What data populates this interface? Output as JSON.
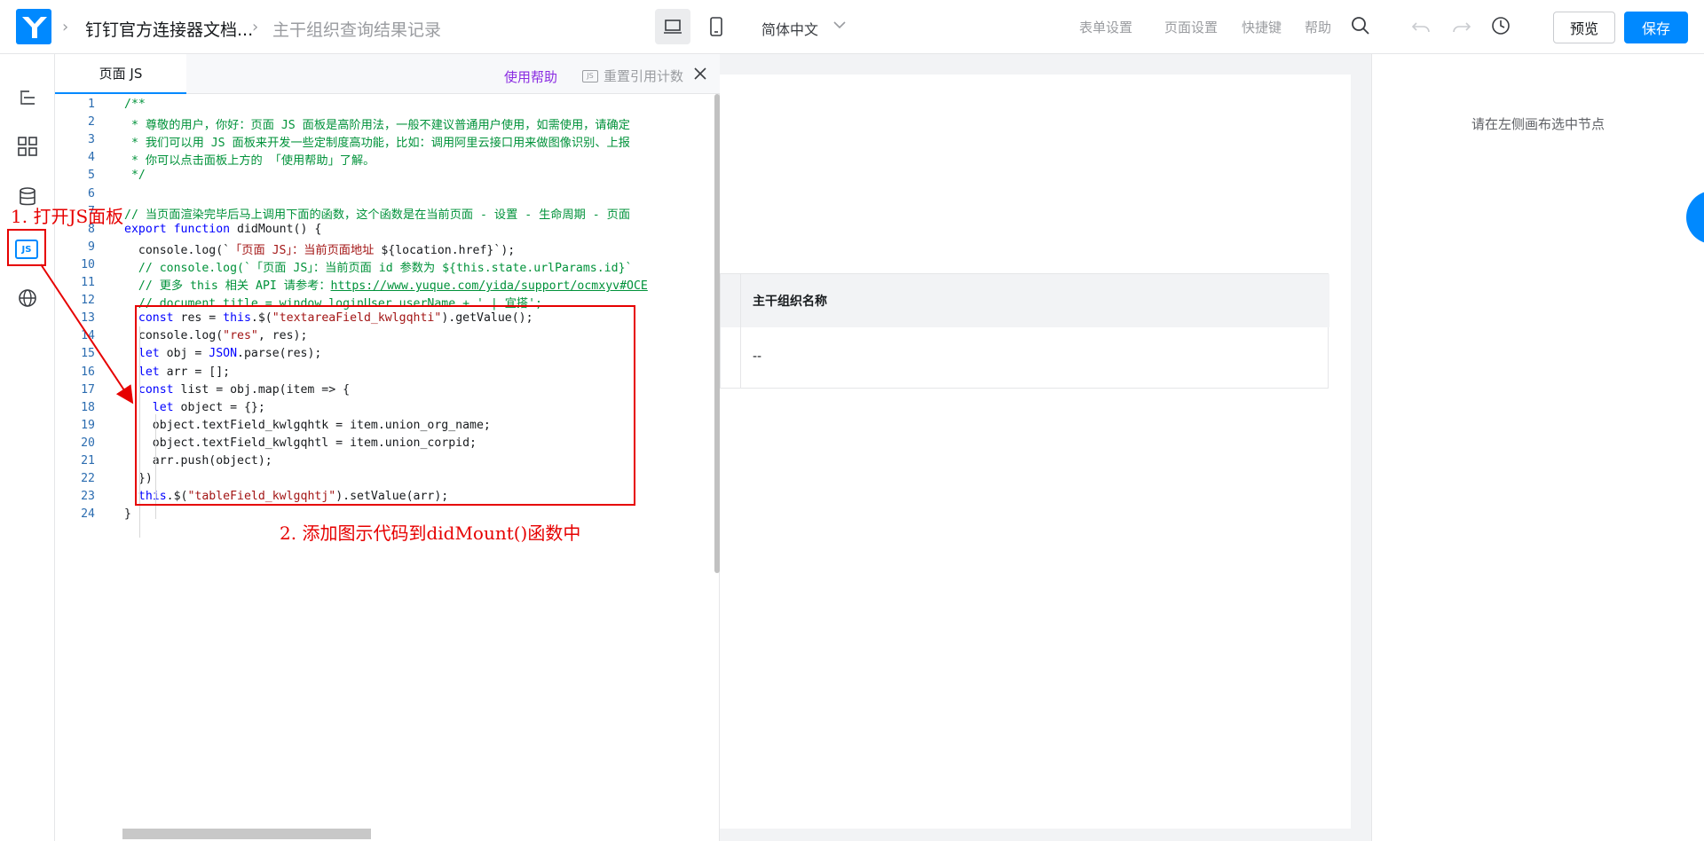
{
  "header": {
    "breadcrumbs": [
      "钉钉官方连接器文档...",
      "主干组织查询结果记录"
    ],
    "language": "简体中文",
    "nav": [
      "表单设置",
      "页面设置",
      "快捷键",
      "帮助"
    ],
    "preview_label": "预览",
    "save_label": "保存"
  },
  "js_panel": {
    "tab_label": "页面 JS",
    "help_label": "使用帮助",
    "reset_label": "重置引用计数",
    "reset_icon_text": "JS",
    "lines": [
      {
        "n": "1",
        "parts": [
          {
            "t": "/**",
            "c": "cm"
          }
        ]
      },
      {
        "n": "2",
        "parts": [
          {
            "t": " * 尊敬的用户，你好：页面 JS 面板是高阶用法，一般不建议普通用户使用，如需使用，请确定",
            "c": "cm"
          }
        ]
      },
      {
        "n": "3",
        "parts": [
          {
            "t": " * 我们可以用 JS 面板来开发一些定制度高功能，比如：调用阿里云接口用来做图像识别、上报",
            "c": "cm"
          }
        ]
      },
      {
        "n": "4",
        "parts": [
          {
            "t": " * 你可以点击面板上方的 「使用帮助」了解。",
            "c": "cm"
          }
        ]
      },
      {
        "n": "5",
        "parts": [
          {
            "t": " */",
            "c": "cm"
          }
        ]
      },
      {
        "n": "6",
        "parts": [
          {
            "t": "",
            "c": ""
          }
        ]
      },
      {
        "n": "7",
        "parts": [
          {
            "t": "// 当页面渲染完毕后马上调用下面的函数，这个函数是在当前页面 - 设置 - 生命周期 - 页面",
            "c": "cm"
          }
        ]
      },
      {
        "n": "8",
        "parts": [
          {
            "t": "export function",
            "c": "kw"
          },
          {
            "t": " didMount() {",
            "c": ""
          }
        ]
      },
      {
        "n": "9",
        "parts": [
          {
            "t": "  console.log(`",
            "c": ""
          },
          {
            "t": "「页面 JS」：当前页面地址 ",
            "c": "str"
          },
          {
            "t": "${location.href}",
            "c": ""
          },
          {
            "t": "`);",
            "c": ""
          }
        ]
      },
      {
        "n": "10",
        "parts": [
          {
            "t": "  // console.log(`「页面 JS」：当前页面 id 参数为 ${this.state.urlParams.id}`",
            "c": "cm"
          }
        ]
      },
      {
        "n": "11",
        "parts": [
          {
            "t": "  // 更多 this 相关 API 请参考：",
            "c": "cm"
          },
          {
            "t": "https://www.yuque.com/yida/support/ocmxyv#OCE",
            "c": "url"
          }
        ]
      },
      {
        "n": "12",
        "parts": [
          {
            "t": "  // document.title = window.loginUser.userName + ' | 宜搭';",
            "c": "cm"
          }
        ]
      },
      {
        "n": "13",
        "parts": [
          {
            "t": "  const",
            "c": "kw"
          },
          {
            "t": " res = ",
            "c": ""
          },
          {
            "t": "this",
            "c": "kw"
          },
          {
            "t": ".$(",
            "c": ""
          },
          {
            "t": "\"textareaField_kwlgqhti\"",
            "c": "str"
          },
          {
            "t": ").getValue();",
            "c": ""
          }
        ]
      },
      {
        "n": "14",
        "parts": [
          {
            "t": "  console.log(",
            "c": ""
          },
          {
            "t": "\"res\"",
            "c": "str"
          },
          {
            "t": ", res);",
            "c": ""
          }
        ]
      },
      {
        "n": "15",
        "parts": [
          {
            "t": "  let",
            "c": "kw"
          },
          {
            "t": " obj = ",
            "c": ""
          },
          {
            "t": "JSON",
            "c": "kw"
          },
          {
            "t": ".parse(res);",
            "c": ""
          }
        ]
      },
      {
        "n": "16",
        "parts": [
          {
            "t": "  let",
            "c": "kw"
          },
          {
            "t": " arr = [];",
            "c": ""
          }
        ]
      },
      {
        "n": "17",
        "parts": [
          {
            "t": "  const",
            "c": "kw"
          },
          {
            "t": " list = obj.map(item => {",
            "c": ""
          }
        ]
      },
      {
        "n": "18",
        "parts": [
          {
            "t": "    let",
            "c": "kw"
          },
          {
            "t": " object = {};",
            "c": ""
          }
        ]
      },
      {
        "n": "19",
        "parts": [
          {
            "t": "    object.textField_kwlgqhtk = item.union_org_name;",
            "c": ""
          }
        ]
      },
      {
        "n": "20",
        "parts": [
          {
            "t": "    object.textField_kwlgqhtl = item.union_corpid;",
            "c": ""
          }
        ]
      },
      {
        "n": "21",
        "parts": [
          {
            "t": "    arr.push(object);",
            "c": ""
          }
        ]
      },
      {
        "n": "22",
        "parts": [
          {
            "t": "  })",
            "c": ""
          }
        ]
      },
      {
        "n": "23",
        "parts": [
          {
            "t": "  this",
            "c": "kw"
          },
          {
            "t": ".$(",
            "c": ""
          },
          {
            "t": "\"tableField_kwlgqhtj\"",
            "c": "str"
          },
          {
            "t": ").setValue(arr);",
            "c": ""
          }
        ]
      },
      {
        "n": "24",
        "parts": [
          {
            "t": "}",
            "c": ""
          }
        ]
      }
    ]
  },
  "canvas": {
    "table_header": "主干组织名称",
    "table_cell": "--"
  },
  "right_panel": {
    "hint": "请在左侧画布选中节点"
  },
  "annotations": {
    "step1": "1. 打开JS面板",
    "step2": "2. 添加图示代码到didMount()函数中"
  },
  "colors": {
    "accent": "#0089ff",
    "annotation": "#e60000"
  }
}
